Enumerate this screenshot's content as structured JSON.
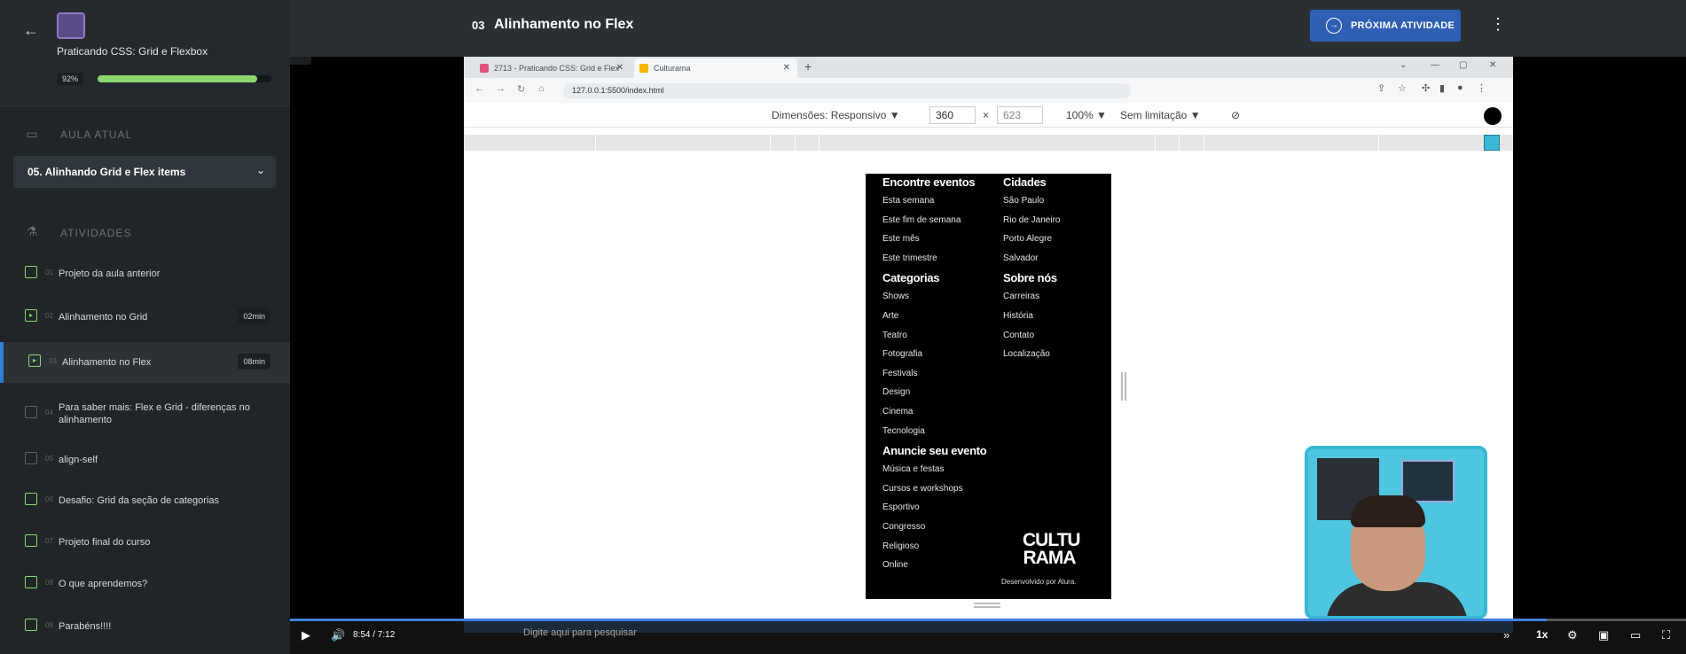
{
  "sidebar": {
    "back_icon": "arrow-left-icon",
    "course_title": "Praticando CSS: Grid e Flexbox",
    "progress_label": "92%",
    "progress_value": 0.92,
    "current_section_label": "AULA ATUAL",
    "current_lesson": "05. Alinhando Grid e Flex items",
    "activities_label": "ATIVIDADES",
    "activities": [
      {
        "num": "01",
        "title": "Projeto da aula anterior",
        "time": "",
        "icon": "book-icon"
      },
      {
        "num": "02",
        "title": "Alinhamento no Grid",
        "time": "02min",
        "icon": "play-icon"
      },
      {
        "num": "03",
        "title": "Alinhamento no Flex",
        "time": "08min",
        "icon": "play-icon"
      },
      {
        "num": "04",
        "title": "Para saber mais: Flex e Grid - diferenças no alinhamento",
        "time": "",
        "icon": "plus-circle-icon"
      },
      {
        "num": "05",
        "title": "align-self",
        "time": "",
        "icon": "list-icon"
      },
      {
        "num": "06",
        "title": "Desafio: Grid da seção de categorias",
        "time": "",
        "icon": "book-icon"
      },
      {
        "num": "07",
        "title": "Projeto final do curso",
        "time": "",
        "icon": "book-icon"
      },
      {
        "num": "08",
        "title": "O que aprendemos?",
        "time": "",
        "icon": "person-check-icon"
      },
      {
        "num": "09",
        "title": "Parabéns!!!!",
        "time": "",
        "icon": "book-icon"
      }
    ]
  },
  "header": {
    "lesson_num": "03",
    "lesson_title": "Alinhamento no Flex",
    "next_label": "PRÓXIMA ATIVIDADE"
  },
  "browser": {
    "tab1": "2713 - Praticando CSS: Grid e Flex",
    "tab2": "Culturama",
    "url": "127.0.0.1:5500/index.html",
    "dev_dimensions": "Dimensões: Responsivo ▼",
    "dev_width": "360",
    "dev_x": "×",
    "dev_height": "623",
    "dev_zoom": "100% ▼",
    "dev_throttle": "Sem limitação ▼"
  },
  "site": {
    "col1": [
      {
        "heading": "Encontre eventos",
        "items": [
          "Esta semana",
          "Este fim de semana",
          "Este mês",
          "Este trimestre"
        ]
      },
      {
        "heading": "Categorias",
        "items": [
          "Shows",
          "Arte",
          "Teatro",
          "Fotografia",
          "Festivals",
          "Design",
          "Cinema",
          "Tecnologia"
        ]
      },
      {
        "heading": "Anuncie seu evento",
        "items": [
          "Música e festas",
          "Cursos e workshops",
          "Esportivo",
          "Congresso",
          "Religioso",
          "Online"
        ]
      }
    ],
    "col2": [
      {
        "heading": "Cidades",
        "items": [
          "São Paulo",
          "Rio de Janeiro",
          "Porto Alegre",
          "Salvador"
        ]
      },
      {
        "heading": "Sobre nós",
        "items": [
          "Carreiras",
          "História",
          "Contato",
          "Localização"
        ]
      }
    ],
    "logo": "CULTU RAMA",
    "credit": "Desenvolvido por Alura."
  },
  "player": {
    "time": "8:54  /  7:12",
    "speed": "1x",
    "progress_value": 0.9,
    "taskbar_search": "Digite aqui para pesquisar"
  }
}
